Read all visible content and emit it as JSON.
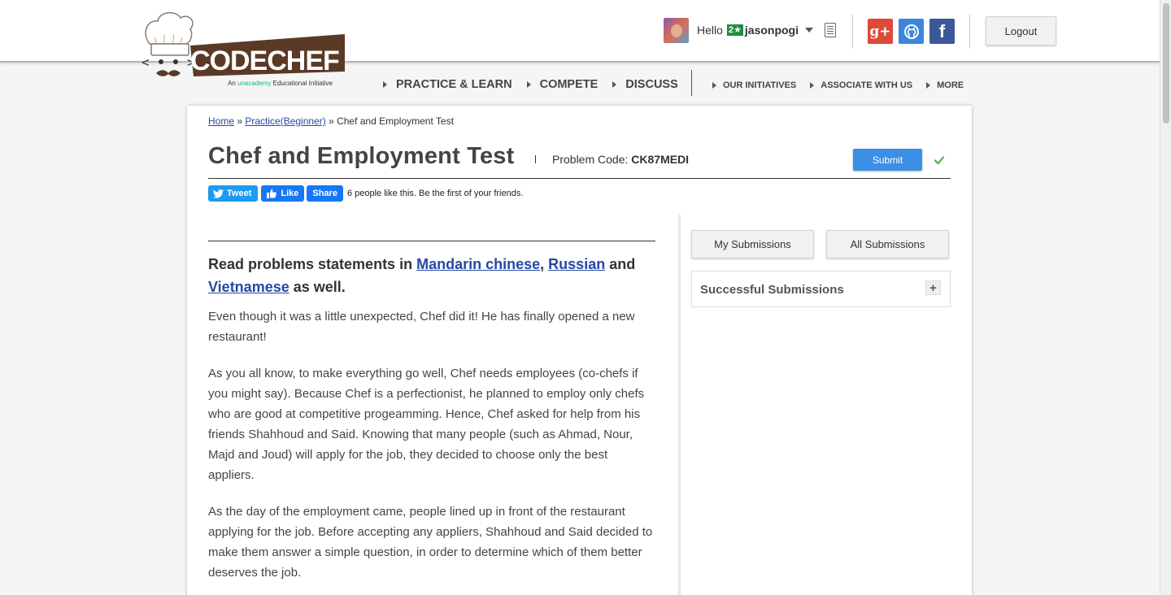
{
  "header": {
    "logo_text": "CODECHEF",
    "tagline_prefix": "An",
    "tagline_brand": "unacademy",
    "tagline_suffix": "Educational Initiative",
    "greeting": "Hello",
    "star_badge": "2★",
    "username": "jasonpogi",
    "logout_label": "Logout",
    "social": {
      "gplus": "g+",
      "facebook": "f"
    }
  },
  "nav": {
    "main": [
      "PRACTICE & LEARN",
      "COMPETE",
      "DISCUSS"
    ],
    "secondary": [
      "OUR INITIATIVES",
      "ASSOCIATE WITH US",
      "MORE"
    ]
  },
  "breadcrumb": {
    "home": "Home",
    "sep1": " » ",
    "practice": "Practice(Beginner)",
    "sep2": " » ",
    "current": "Chef and Employment Test"
  },
  "problem": {
    "title": "Chef and Employment Test",
    "code_label": "Problem Code:",
    "code": "CK87MEDI",
    "submit_label": "Submit"
  },
  "share": {
    "tweet": "Tweet",
    "like": "Like",
    "share": "Share",
    "like_text": "6 people like this. Be the first of your friends."
  },
  "statement": {
    "lang_prefix": "Read problems statements in",
    "lang1": "Mandarin chinese",
    "comma": ",",
    "lang2": "Russian",
    "and": "and",
    "lang3": "Vietnamese",
    "suffix": "as well.",
    "paragraphs": [
      "Even though it was a little unexpected, Chef did it! He has finally opened a new restaurant!",
      "As you all know, to make everything go well, Chef needs employees (co-chefs if you might say). Because Chef is a perfectionist, he planned to employ only chefs who are good at competitive progeamming. Hence, Chef asked for help from his friends Shahhoud and Said. Knowing that many people (such as Ahmad, Nour, Majd and Joud) will apply for the job, they decided to choose only the best appliers.",
      "As the day of the employment came, people lined up in front of the restaurant applying for the job. Before accepting any appliers, Shahhoud and Said decided to make them answer a simple question, in order to determine which of them better deserves the job."
    ]
  },
  "sidebar": {
    "my_submissions": "My Submissions",
    "all_submissions": "All Submissions",
    "successful_submissions": "Successful Submissions",
    "expand": "+"
  },
  "colors": {
    "link": "#2548a6",
    "submit": "#3b8fe5",
    "brand_brown": "#5a3a26",
    "check": "#5cb85c"
  }
}
